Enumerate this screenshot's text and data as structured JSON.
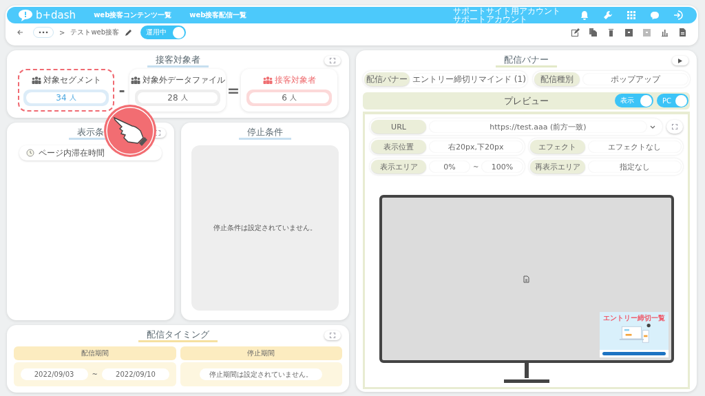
{
  "header": {
    "brand": "b+dash",
    "nav": [
      {
        "label": "web接客コンテンツ一覧"
      },
      {
        "label": "web接客配信一覧"
      }
    ],
    "account": [
      "サポートサイト用アカウント",
      "サポートアカウント"
    ]
  },
  "breadcrumb": {
    "separator": ">",
    "title": "テストweb接客",
    "status": {
      "label": "運用中",
      "on": true
    }
  },
  "target": {
    "title": "接客対象者",
    "minus": "-",
    "equals": "=",
    "boxes": [
      {
        "kind": "segment",
        "label": "対象セグメント",
        "value": "34",
        "unit": "人",
        "highlighted": true
      },
      {
        "kind": "excluded",
        "label": "対象外データファイル",
        "value": "28",
        "unit": "人",
        "highlighted": false
      },
      {
        "kind": "result",
        "label": "接客対象者",
        "value": "6",
        "unit": "人",
        "highlighted": false
      }
    ]
  },
  "display_conditions": {
    "title": "表示条",
    "items": [
      {
        "label": "ページ内滞在時間"
      }
    ]
  },
  "stop_conditions": {
    "title": "停止条件",
    "message": "停止条件は設定されていません。"
  },
  "timing": {
    "title": "配信タイミング",
    "period": {
      "header": "配信期間",
      "start": "2022/09/03",
      "tilde": "~",
      "end": "2022/09/10"
    },
    "stop": {
      "header": "停止期間",
      "message": "停止期間は設定されていません。"
    }
  },
  "banner": {
    "title": "配信バナー",
    "fields": [
      {
        "label": "配信バナー",
        "value": "エントリー締切リマインド (1)"
      },
      {
        "label": "配信種別",
        "value": "ポップアップ"
      }
    ],
    "preview": {
      "title": "プレビュー",
      "toggles": [
        {
          "label": "表示",
          "on": true
        },
        {
          "label": "PC",
          "on": true
        }
      ],
      "url": {
        "label": "URL",
        "value": "https://test.aaa (前方一致)"
      },
      "position": {
        "label": "表示位置",
        "value": "右20px,下20px"
      },
      "effect": {
        "label": "エフェクト",
        "value": "エフェクトなし"
      },
      "area": {
        "label": "表示エリア",
        "from": "0%",
        "tilde": "~",
        "to": "100%"
      },
      "redisplay": {
        "label": "再表示エリア",
        "value": "指定なし"
      },
      "thumbnail_heading": "エントリー締切一覧"
    }
  }
}
